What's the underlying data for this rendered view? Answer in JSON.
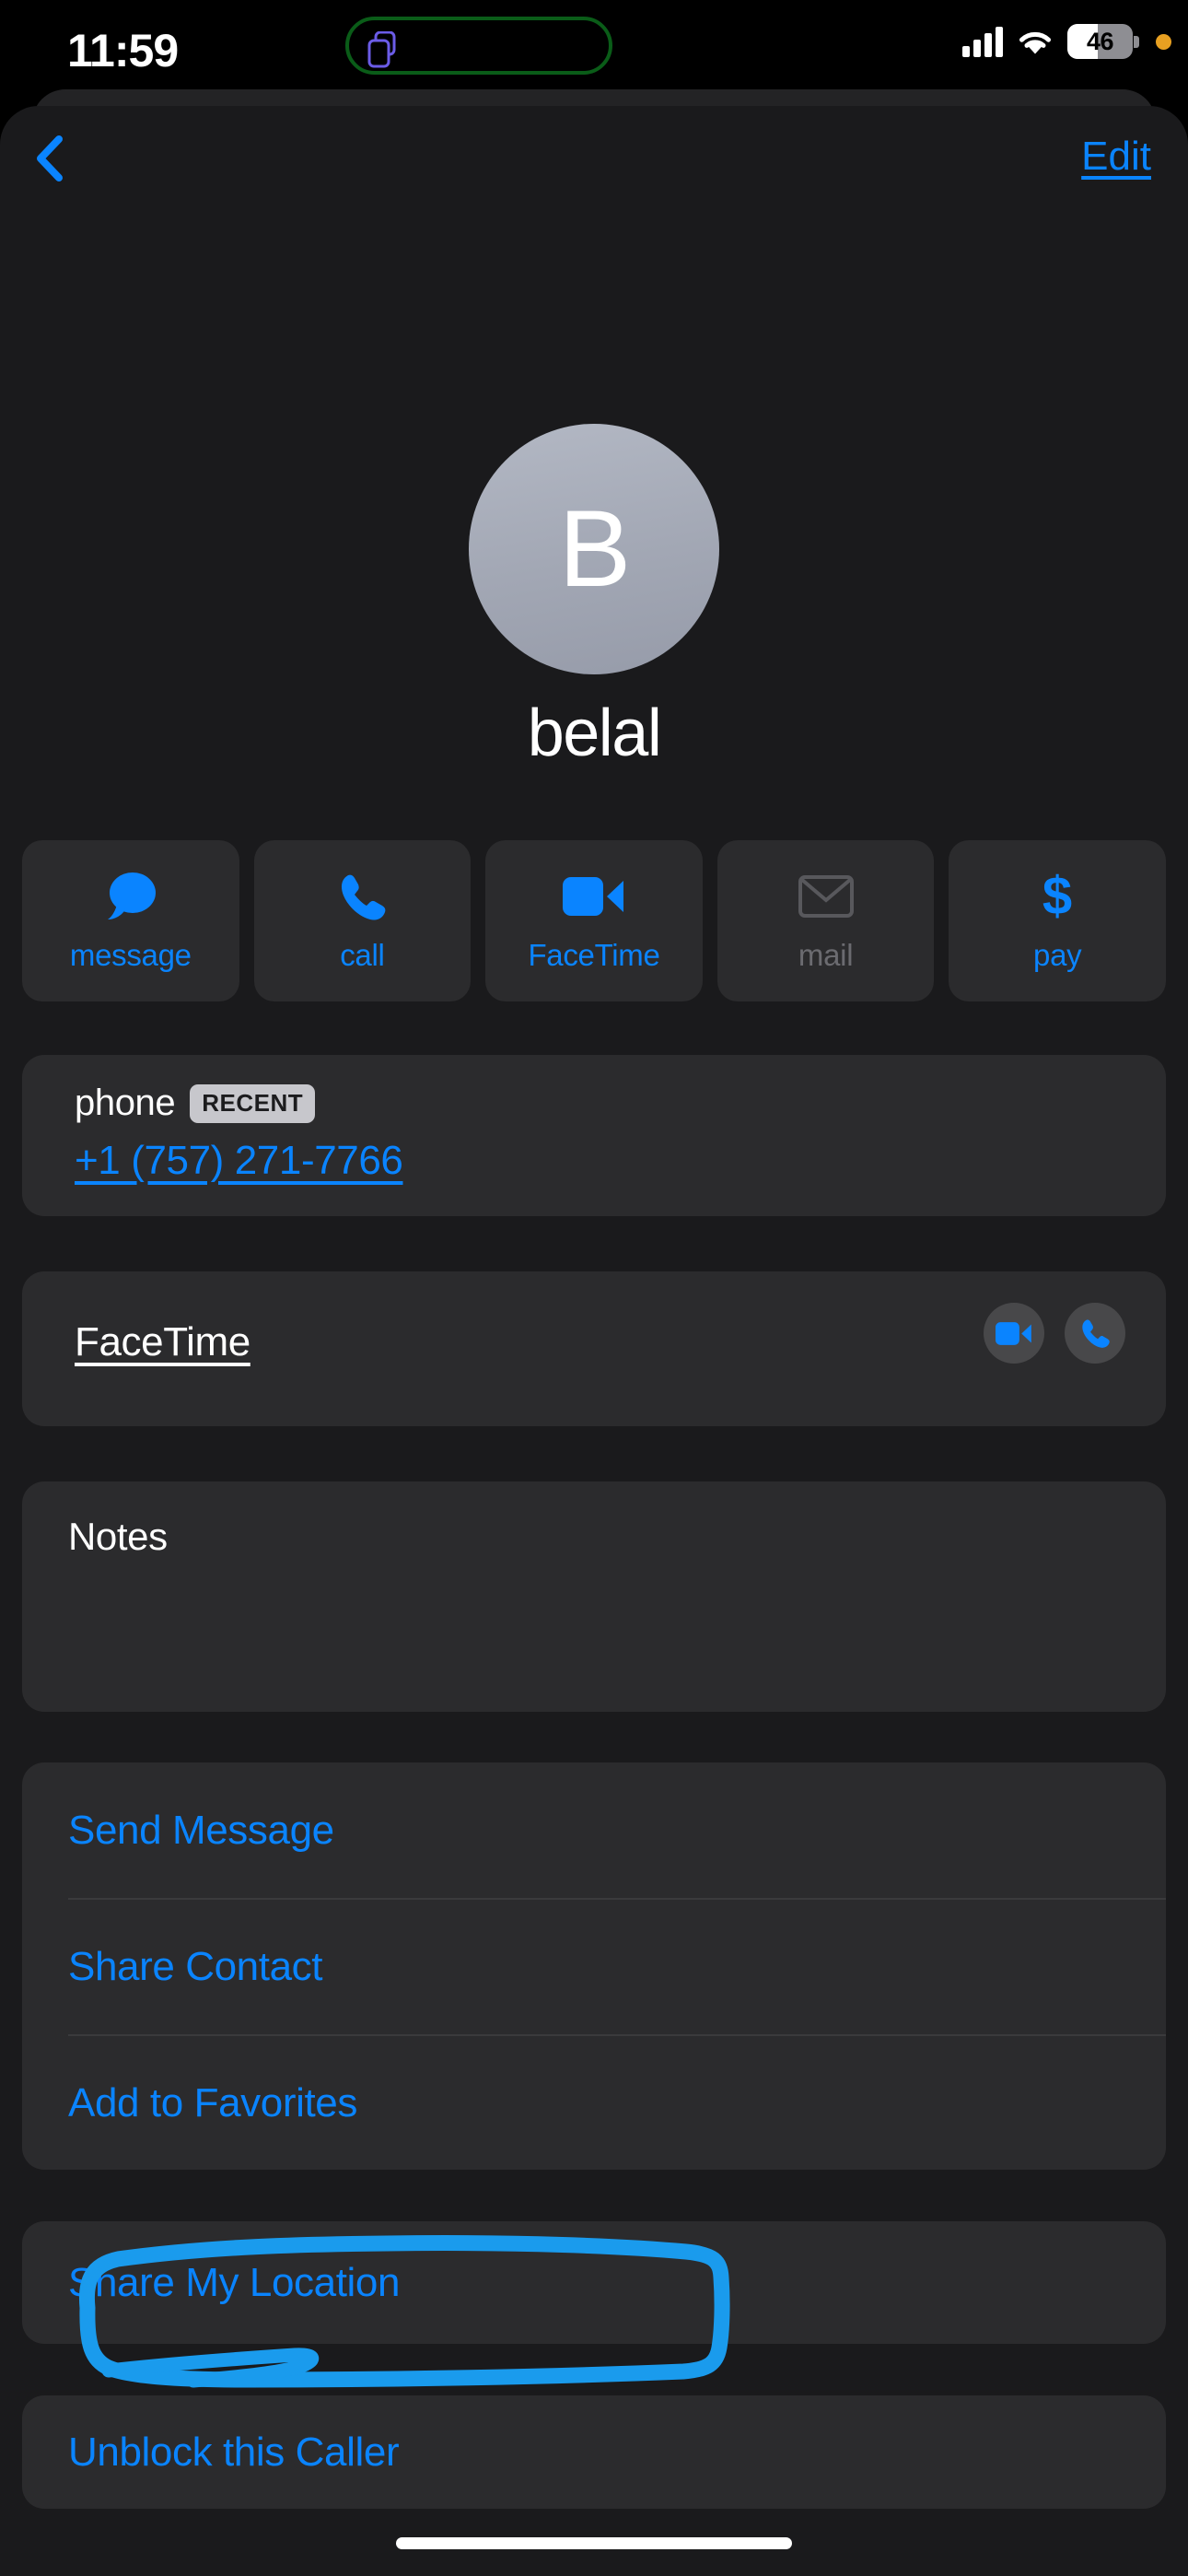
{
  "status_bar": {
    "time": "11:59",
    "island_icon": "screen-mirroring-icon",
    "recording_outline_color": "#0a5c18",
    "cellular_icon": "signal-bars-icon",
    "wifi_icon": "wifi-icon",
    "battery_percent": "46",
    "battery_level": 46,
    "privacy_indicator": "microphone-in-use-dot",
    "privacy_indicator_color": "#e8a021"
  },
  "nav": {
    "back_icon": "chevron-left-icon",
    "edit_label": "Edit"
  },
  "contact": {
    "avatar_initial": "B",
    "name": "belal"
  },
  "actions": [
    {
      "label": "message",
      "icon": "message-bubble-icon",
      "enabled": true
    },
    {
      "label": "call",
      "icon": "phone-icon",
      "enabled": true
    },
    {
      "label": "FaceTime",
      "icon": "video-camera-icon",
      "enabled": true
    },
    {
      "label": "mail",
      "icon": "envelope-icon",
      "enabled": false
    },
    {
      "label": "pay",
      "icon": "dollar-sign-icon",
      "enabled": true
    }
  ],
  "phone_section": {
    "label": "phone",
    "badge": "RECENT",
    "number": "+1 (757) 271-7766"
  },
  "facetime_section": {
    "label": "FaceTime",
    "video_icon": "video-camera-icon",
    "audio_icon": "phone-icon"
  },
  "notes_section": {
    "label": "Notes",
    "value": ""
  },
  "links_group": [
    {
      "label": "Send Message"
    },
    {
      "label": "Share Contact"
    },
    {
      "label": "Add to Favorites"
    }
  ],
  "location_group": [
    {
      "label": "Share My Location"
    }
  ],
  "unblock_group": [
    {
      "label": "Unblock this Caller"
    }
  ],
  "annotation": {
    "type": "freehand-circle-highlight",
    "target": "Unblock this Caller",
    "color": "#1a9bed"
  },
  "colors": {
    "accent_blue": "#0a84ff",
    "page_background": "#1a1a1c",
    "card_background": "#2b2b2d",
    "disabled_gray": "#6b6b70"
  }
}
